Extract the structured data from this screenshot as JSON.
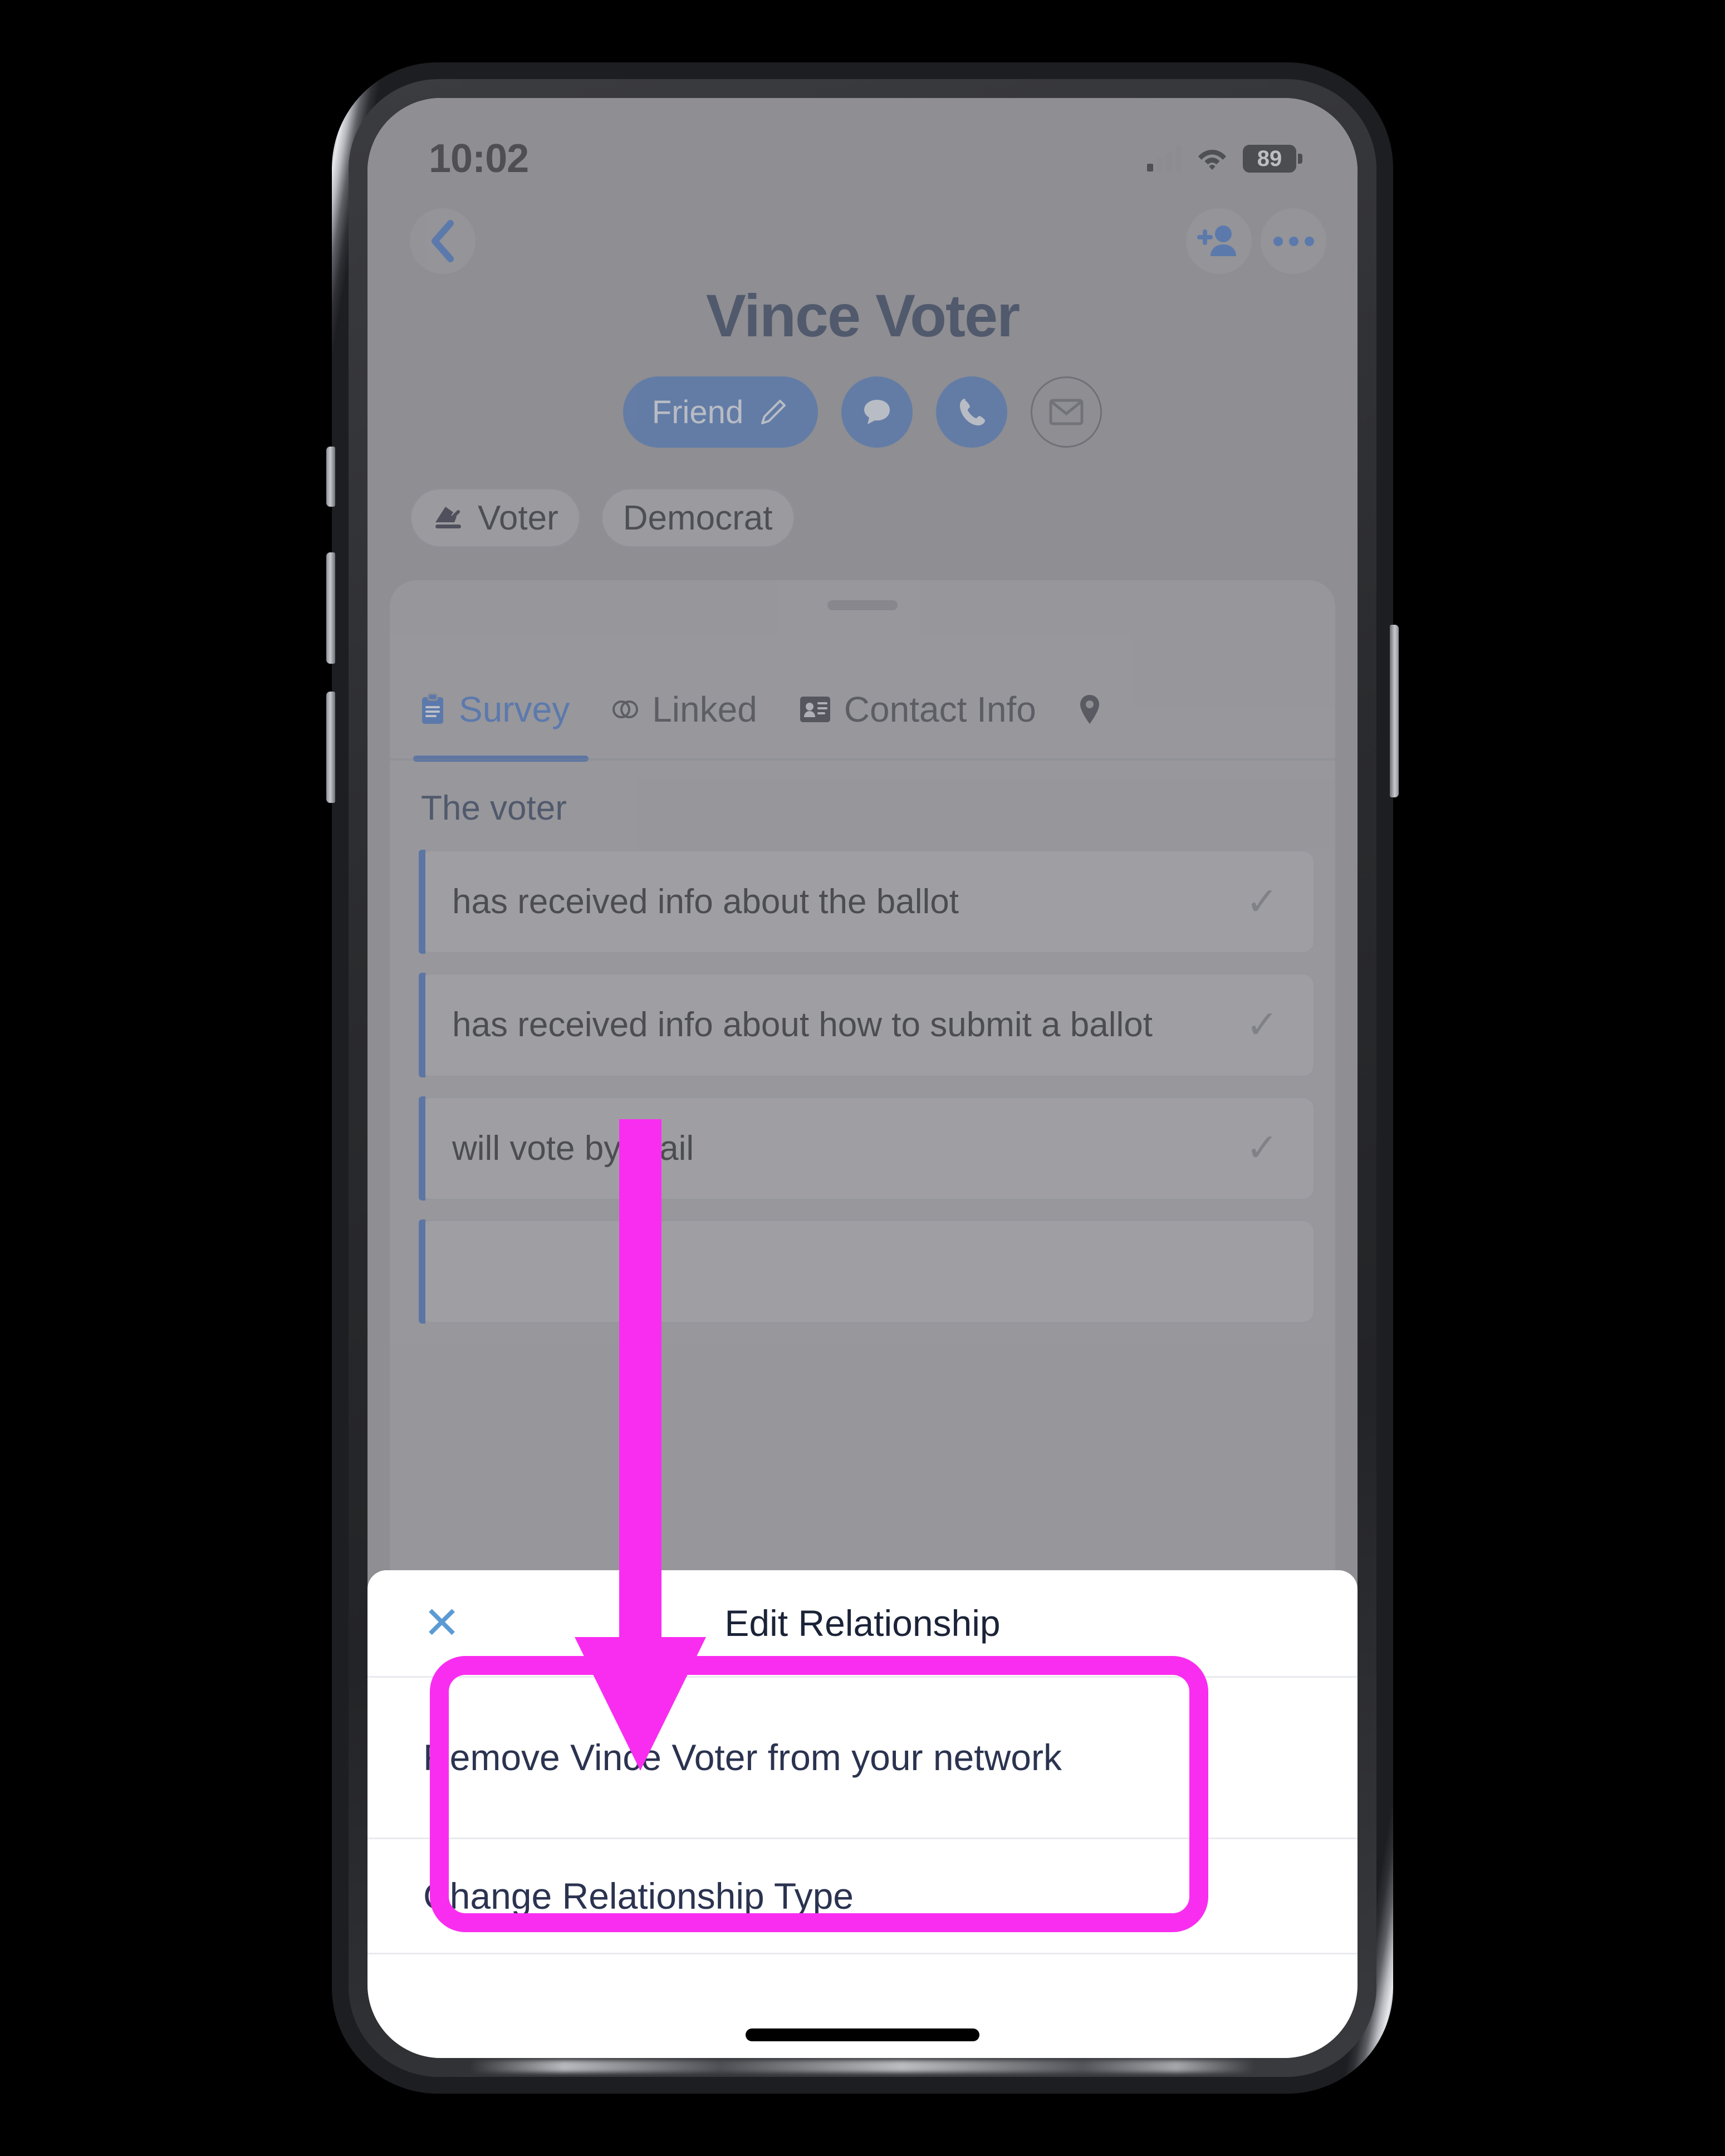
{
  "status_bar": {
    "time": "10:02",
    "battery_percent": "89",
    "signal_icon": "cellular-bars-icon",
    "wifi_icon": "wifi-icon",
    "battery_icon": "battery-icon"
  },
  "nav": {
    "back_icon": "chevron-left-icon",
    "add_person_icon": "add-person-icon",
    "more_icon": "more-horizontal-icon"
  },
  "profile": {
    "name": "Vince Voter",
    "relationship_chip": {
      "label": "Friend",
      "edit_icon": "pencil-icon"
    },
    "actions": [
      {
        "name": "message",
        "icon": "chat-bubble-icon",
        "style": "filled"
      },
      {
        "name": "call",
        "icon": "phone-icon",
        "style": "filled"
      },
      {
        "name": "email",
        "icon": "envelope-icon",
        "style": "outline"
      }
    ],
    "tags": [
      {
        "label": "Voter",
        "icon": "ballot-box-icon"
      },
      {
        "label": "Democrat",
        "icon": ""
      }
    ]
  },
  "tabs": [
    {
      "label": "Survey",
      "icon": "clipboard-icon",
      "active": true
    },
    {
      "label": "Linked",
      "icon": "link-icon",
      "active": false
    },
    {
      "label": "Contact Info",
      "icon": "contact-card-icon",
      "active": false
    },
    {
      "label": "",
      "icon": "map-pin-icon",
      "active": false
    }
  ],
  "survey": {
    "section_title": "The voter",
    "questions": [
      {
        "text": "has received info about the ballot",
        "check_icon": "check-icon"
      },
      {
        "text": "has received info about how to submit a ballot",
        "check_icon": "check-icon"
      },
      {
        "text": "will vote by mail",
        "check_icon": "check-icon"
      }
    ]
  },
  "bottom_sheet": {
    "close_icon": "close-x-icon",
    "close_label": "✕",
    "title": "Edit Relationship",
    "options": [
      {
        "label": "Remove Vince Voter from your network"
      },
      {
        "label": "Change Relationship Type"
      }
    ]
  },
  "annotations": {
    "arrow_color": "#f92df0",
    "highlight_color": "#f92df0",
    "arrow_name": "pointer-arrow",
    "highlight_name": "highlight-rectangle"
  },
  "colors": {
    "accent_blue": "#2f66c4",
    "chip_blue": "#3d6cb9",
    "text_navy": "#1b2b4a",
    "magenta": "#f92df0",
    "dim_overlay": "#8e8e93"
  }
}
